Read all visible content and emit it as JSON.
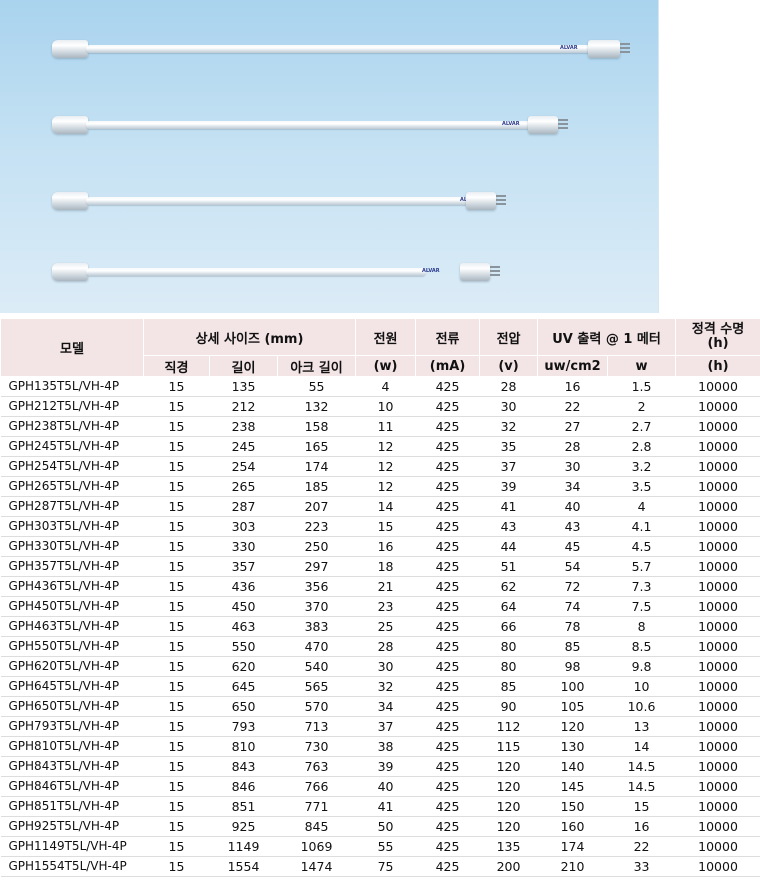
{
  "photo": {
    "alt_icon": "uv-lamp-tubes-photo",
    "background": "#b8dbf0",
    "logo_text": "ALVAR"
  },
  "table": {
    "header": {
      "model": "모델",
      "size": "상세 사이즈 (mm)",
      "power": "전원",
      "current": "전류",
      "voltage": "전압",
      "uv_output": "UV 출력 @ 1 메터",
      "life": "정격 수명\n(h)",
      "diameter": "직경",
      "length": "길이",
      "arc_length": "아크 길이",
      "power_unit": "(w)",
      "current_unit": "(mA)",
      "voltage_unit": "(v)",
      "uv_unit1": "uw/cm2",
      "uv_unit2": "w",
      "life_unit": "(h)"
    },
    "header_bg": "#f3e4e6",
    "rows": [
      [
        "GPH135T5L/VH-4P",
        "15",
        "135",
        "55",
        "4",
        "425",
        "28",
        "16",
        "1.5",
        "10000"
      ],
      [
        "GPH212T5L/VH-4P",
        "15",
        "212",
        "132",
        "10",
        "425",
        "30",
        "22",
        "2",
        "10000"
      ],
      [
        "GPH238T5L/VH-4P",
        "15",
        "238",
        "158",
        "11",
        "425",
        "32",
        "27",
        "2.7",
        "10000"
      ],
      [
        "GPH245T5L/VH-4P",
        "15",
        "245",
        "165",
        "12",
        "425",
        "35",
        "28",
        "2.8",
        "10000"
      ],
      [
        "GPH254T5L/VH-4P",
        "15",
        "254",
        "174",
        "12",
        "425",
        "37",
        "30",
        "3.2",
        "10000"
      ],
      [
        "GPH265T5L/VH-4P",
        "15",
        "265",
        "185",
        "12",
        "425",
        "39",
        "34",
        "3.5",
        "10000"
      ],
      [
        "GPH287T5L/VH-4P",
        "15",
        "287",
        "207",
        "14",
        "425",
        "41",
        "40",
        "4",
        "10000"
      ],
      [
        "GPH303T5L/VH-4P",
        "15",
        "303",
        "223",
        "15",
        "425",
        "43",
        "43",
        "4.1",
        "10000"
      ],
      [
        "GPH330T5L/VH-4P",
        "15",
        "330",
        "250",
        "16",
        "425",
        "44",
        "45",
        "4.5",
        "10000"
      ],
      [
        "GPH357T5L/VH-4P",
        "15",
        "357",
        "297",
        "18",
        "425",
        "51",
        "54",
        "5.7",
        "10000"
      ],
      [
        "GPH436T5L/VH-4P",
        "15",
        "436",
        "356",
        "21",
        "425",
        "62",
        "72",
        "7.3",
        "10000"
      ],
      [
        "GPH450T5L/VH-4P",
        "15",
        "450",
        "370",
        "23",
        "425",
        "64",
        "74",
        "7.5",
        "10000"
      ],
      [
        "GPH463T5L/VH-4P",
        "15",
        "463",
        "383",
        "25",
        "425",
        "66",
        "78",
        "8",
        "10000"
      ],
      [
        "GPH550T5L/VH-4P",
        "15",
        "550",
        "470",
        "28",
        "425",
        "80",
        "85",
        "8.5",
        "10000"
      ],
      [
        "GPH620T5L/VH-4P",
        "15",
        "620",
        "540",
        "30",
        "425",
        "80",
        "98",
        "9.8",
        "10000"
      ],
      [
        "GPH645T5L/VH-4P",
        "15",
        "645",
        "565",
        "32",
        "425",
        "85",
        "100",
        "10",
        "10000"
      ],
      [
        "GPH650T5L/VH-4P",
        "15",
        "650",
        "570",
        "34",
        "425",
        "90",
        "105",
        "10.6",
        "10000"
      ],
      [
        "GPH793T5L/VH-4P",
        "15",
        "793",
        "713",
        "37",
        "425",
        "112",
        "120",
        "13",
        "10000"
      ],
      [
        "GPH810T5L/VH-4P",
        "15",
        "810",
        "730",
        "38",
        "425",
        "115",
        "130",
        "14",
        "10000"
      ],
      [
        "GPH843T5L/VH-4P",
        "15",
        "843",
        "763",
        "39",
        "425",
        "120",
        "140",
        "14.5",
        "10000"
      ],
      [
        "GPH846T5L/VH-4P",
        "15",
        "846",
        "766",
        "40",
        "425",
        "120",
        "145",
        "14.5",
        "10000"
      ],
      [
        "GPH851T5L/VH-4P",
        "15",
        "851",
        "771",
        "41",
        "425",
        "120",
        "150",
        "15",
        "10000"
      ],
      [
        "GPH925T5L/VH-4P",
        "15",
        "925",
        "845",
        "50",
        "425",
        "120",
        "160",
        "16",
        "10000"
      ],
      [
        "GPH1149T5L/VH-4P",
        "15",
        "1149",
        "1069",
        "55",
        "425",
        "135",
        "174",
        "22",
        "10000"
      ],
      [
        "GPH1554T5L/VH-4P",
        "15",
        "1554",
        "1474",
        "75",
        "425",
        "200",
        "210",
        "33",
        "10000"
      ]
    ]
  }
}
